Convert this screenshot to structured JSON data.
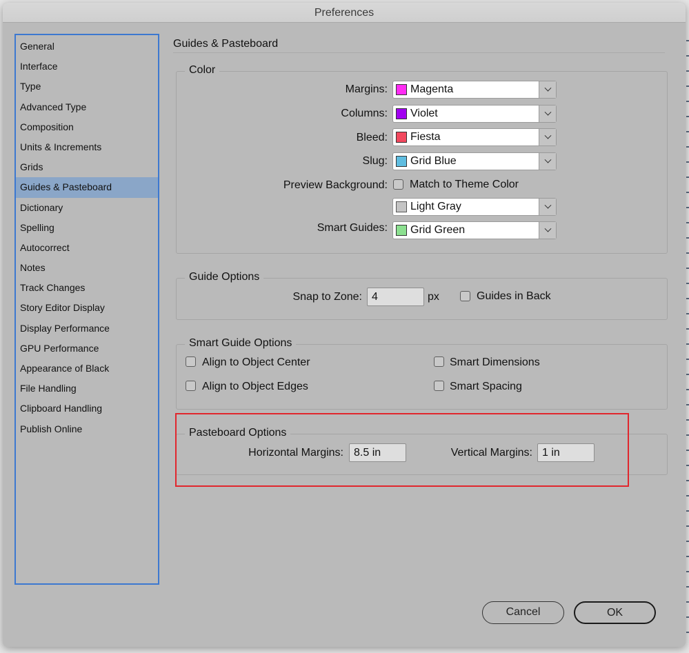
{
  "window": {
    "title": "Preferences"
  },
  "sidebar": {
    "selected_index": 7,
    "items": [
      {
        "label": "General"
      },
      {
        "label": "Interface"
      },
      {
        "label": "Type"
      },
      {
        "label": "Advanced Type"
      },
      {
        "label": "Composition"
      },
      {
        "label": "Units & Increments"
      },
      {
        "label": "Grids"
      },
      {
        "label": "Guides & Pasteboard"
      },
      {
        "label": "Dictionary"
      },
      {
        "label": "Spelling"
      },
      {
        "label": "Autocorrect"
      },
      {
        "label": "Notes"
      },
      {
        "label": "Track Changes"
      },
      {
        "label": "Story Editor Display"
      },
      {
        "label": "Display Performance"
      },
      {
        "label": "GPU Performance"
      },
      {
        "label": "Appearance of Black"
      },
      {
        "label": "File Handling"
      },
      {
        "label": "Clipboard Handling"
      },
      {
        "label": "Publish Online"
      }
    ]
  },
  "main": {
    "title": "Guides & Pasteboard",
    "color": {
      "legend": "Color",
      "margins": {
        "label": "Margins:",
        "value": "Magenta",
        "swatch": "#ff2cf3"
      },
      "columns": {
        "label": "Columns:",
        "value": "Violet",
        "swatch": "#a100f0"
      },
      "bleed": {
        "label": "Bleed:",
        "value": "Fiesta",
        "swatch": "#f2485e"
      },
      "slug": {
        "label": "Slug:",
        "value": "Grid Blue",
        "swatch": "#5fbde0"
      },
      "preview_background": {
        "label": "Preview Background:",
        "match_theme_label": "Match to Theme Color",
        "match_theme_checked": false,
        "value": "Light Gray",
        "swatch": "#c4c4c4"
      },
      "smart_guides": {
        "label": "Smart Guides:",
        "value": "Grid Green",
        "swatch": "#8ce090"
      }
    },
    "guide_options": {
      "legend": "Guide Options",
      "snap_label": "Snap to Zone:",
      "snap_value": "4",
      "snap_unit": "px",
      "guides_in_back_label": "Guides in Back",
      "guides_in_back_checked": false
    },
    "smart_guide_options": {
      "legend": "Smart Guide Options",
      "align_center": {
        "label": "Align to Object Center",
        "checked": false
      },
      "align_edges": {
        "label": "Align to Object Edges",
        "checked": false
      },
      "smart_dimensions": {
        "label": "Smart Dimensions",
        "checked": false
      },
      "smart_spacing": {
        "label": "Smart Spacing",
        "checked": false
      }
    },
    "pasteboard_options": {
      "legend": "Pasteboard Options",
      "horizontal_label": "Horizontal Margins:",
      "horizontal_value": "8.5 in",
      "vertical_label": "Vertical Margins:",
      "vertical_value": "1 in",
      "highlight_color": "#e1262d"
    }
  },
  "footer": {
    "cancel_label": "Cancel",
    "ok_label": "OK"
  }
}
